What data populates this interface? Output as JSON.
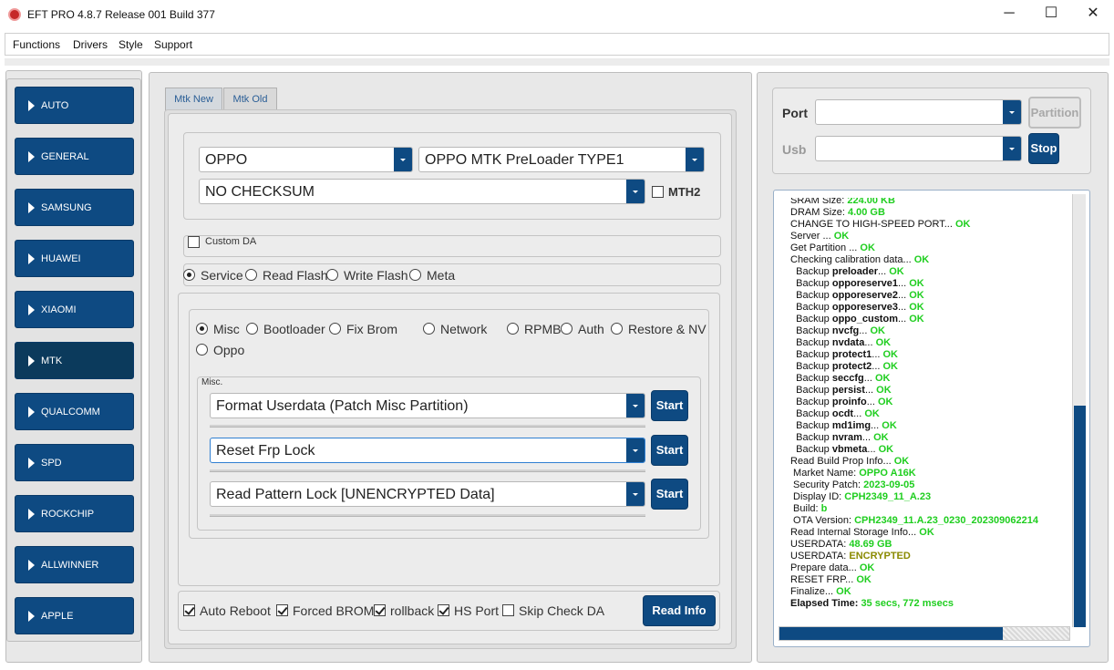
{
  "window": {
    "title": "EFT PRO 4.8.7 Release 001 Build 377",
    "min_glyph": "─",
    "max_glyph": "☐",
    "close_glyph": "✕"
  },
  "menu": [
    "Functions",
    "Drivers",
    "Style",
    "Support"
  ],
  "sidebar": {
    "items": [
      {
        "label": "AUTO"
      },
      {
        "label": "GENERAL"
      },
      {
        "label": "SAMSUNG"
      },
      {
        "label": "HUAWEI"
      },
      {
        "label": "XIAOMI"
      },
      {
        "label": "MTK",
        "active": true
      },
      {
        "label": "QUALCOMM"
      },
      {
        "label": "SPD"
      },
      {
        "label": "ROCKCHIP"
      },
      {
        "label": "ALLWINNER"
      },
      {
        "label": "APPLE"
      }
    ]
  },
  "tabs": [
    {
      "label": "Mtk New",
      "active": true
    },
    {
      "label": "Mtk Old"
    }
  ],
  "device": {
    "brand": "OPPO",
    "model": "OPPO MTK PreLoader TYPE1",
    "checksum": "NO CHECKSUM",
    "mth2_label": "MTH2",
    "mth2_checked": false
  },
  "custom_da": {
    "label": "Custom DA",
    "checked": false
  },
  "mode_options": [
    {
      "label": "Service",
      "checked": true
    },
    {
      "label": "Read Flash"
    },
    {
      "label": "Write Flash"
    },
    {
      "label": "Meta"
    }
  ],
  "service_options": [
    {
      "label": "Misc",
      "checked": true
    },
    {
      "label": "Bootloader"
    },
    {
      "label": "Fix Brom"
    },
    {
      "label": "Network"
    },
    {
      "label": "RPMB"
    },
    {
      "label": "Auth"
    },
    {
      "label": "Restore & NV"
    },
    {
      "label": "Oppo"
    }
  ],
  "misc": {
    "group_label": "Misc.",
    "rows": [
      {
        "value": "Format Userdata (Patch Misc Partition)",
        "button": "Start"
      },
      {
        "value": "Reset Frp Lock",
        "button": "Start"
      },
      {
        "value": "Read Pattern Lock [UNENCRYPTED Data]",
        "button": "Start"
      }
    ]
  },
  "bottom_options": [
    {
      "label": "Auto Reboot",
      "checked": true
    },
    {
      "label": "Forced BROM",
      "checked": true
    },
    {
      "label": "rollback",
      "checked": true
    },
    {
      "label": "HS Port",
      "checked": true
    },
    {
      "label": "Skip Check DA",
      "checked": false
    }
  ],
  "read_info_button": "Read Info",
  "port": {
    "port_label": "Port",
    "usb_label": "Usb",
    "partition_button": "Partition",
    "stop_button": "Stop"
  },
  "log": [
    {
      "text": "SRAM Size: ",
      "value": "224.00 KB"
    },
    {
      "text": "DRAM Size: ",
      "value": "4.00 GB"
    },
    {
      "text": "CHANGE TO HIGH-SPEED PORT... ",
      "ok": "OK"
    },
    {
      "text": "Server ... ",
      "ok": "OK"
    },
    {
      "text": "Get Partition ... ",
      "ok": "OK"
    },
    {
      "text": "Checking calibration data... ",
      "ok": "OK"
    },
    {
      "text": "  Backup ",
      "bold": "preloader",
      "text2": "... ",
      "ok": "OK"
    },
    {
      "text": "  Backup ",
      "bold": "opporeserve1",
      "text2": "... ",
      "ok": "OK"
    },
    {
      "text": "  Backup ",
      "bold": "opporeserve2",
      "text2": "... ",
      "ok": "OK"
    },
    {
      "text": "  Backup ",
      "bold": "opporeserve3",
      "text2": "... ",
      "ok": "OK"
    },
    {
      "text": "  Backup ",
      "bold": "oppo_custom",
      "text2": "... ",
      "ok": "OK"
    },
    {
      "text": "  Backup ",
      "bold": "nvcfg",
      "text2": "... ",
      "ok": "OK"
    },
    {
      "text": "  Backup ",
      "bold": "nvdata",
      "text2": "... ",
      "ok": "OK"
    },
    {
      "text": "  Backup ",
      "bold": "protect1",
      "text2": "... ",
      "ok": "OK"
    },
    {
      "text": "  Backup ",
      "bold": "protect2",
      "text2": "... ",
      "ok": "OK"
    },
    {
      "text": "  Backup ",
      "bold": "seccfg",
      "text2": "... ",
      "ok": "OK"
    },
    {
      "text": "  Backup ",
      "bold": "persist",
      "text2": "... ",
      "ok": "OK"
    },
    {
      "text": "  Backup ",
      "bold": "proinfo",
      "text2": "... ",
      "ok": "OK"
    },
    {
      "text": "  Backup ",
      "bold": "ocdt",
      "text2": "... ",
      "ok": "OK"
    },
    {
      "text": "  Backup ",
      "bold": "md1img",
      "text2": "... ",
      "ok": "OK"
    },
    {
      "text": "  Backup ",
      "bold": "nvram",
      "text2": "... ",
      "ok": "OK"
    },
    {
      "text": "  Backup ",
      "bold": "vbmeta",
      "text2": "... ",
      "ok": "OK"
    },
    {
      "text": "Read Build Prop Info... ",
      "ok": "OK"
    },
    {
      "text": " Market Name: ",
      "value": "OPPO A16K"
    },
    {
      "text": " Security Patch: ",
      "value": "2023-09-05"
    },
    {
      "text": " Display ID: ",
      "value": "CPH2349_11_A.23"
    },
    {
      "text": " Build: ",
      "value": "b"
    },
    {
      "text": " OTA Version: ",
      "value": "CPH2349_11.A.23_0230_202309062214"
    },
    {
      "text": "Read Internal Storage Info... ",
      "ok": "OK"
    },
    {
      "text": "USERDATA: ",
      "value": "48.69 GB"
    },
    {
      "text": "USERDATA: ",
      "enc": "ENCRYPTED"
    },
    {
      "text": "Prepare data... ",
      "ok": "OK"
    },
    {
      "text": "RESET FRP... ",
      "ok": "OK"
    },
    {
      "text": "Finalize... ",
      "ok": "OK"
    },
    {
      "bold": "Elapsed Time: ",
      "value": "35 secs, 772 msecs"
    }
  ]
}
